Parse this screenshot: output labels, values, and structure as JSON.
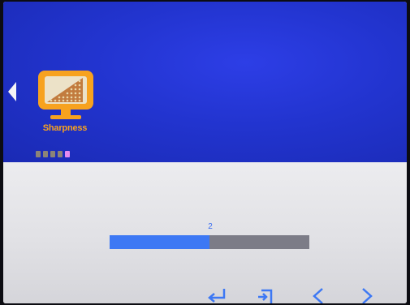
{
  "osd": {
    "menu_item": {
      "label": "Sharpness",
      "icon": "monitor-sharpness-icon"
    },
    "pagination": {
      "total": 5,
      "active_index": 4
    },
    "slider": {
      "value": "2",
      "fill_fraction": 0.5
    },
    "nav_icons": [
      "enter-icon",
      "exit-icon",
      "left-chevron-icon",
      "right-chevron-icon"
    ],
    "colors": {
      "header_blue": "#2234cf",
      "accent_orange": "#f7a21f",
      "slider_fill": "#3d78f4",
      "slider_track": "#7c7c87",
      "active_dot": "#e58af0"
    }
  }
}
